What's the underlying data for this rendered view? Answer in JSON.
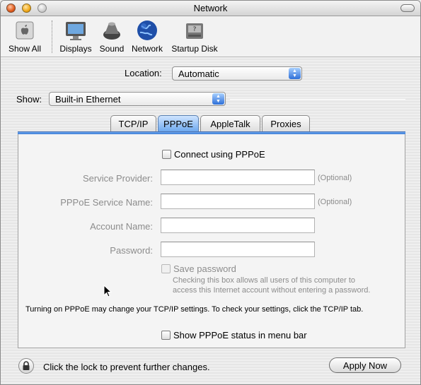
{
  "window": {
    "title": "Network"
  },
  "toolbar": {
    "items": [
      {
        "label": "Show All",
        "icon": "apple-icon"
      },
      {
        "label": "Displays",
        "icon": "display-icon"
      },
      {
        "label": "Sound",
        "icon": "speaker-icon"
      },
      {
        "label": "Network",
        "icon": "globe-icon"
      },
      {
        "label": "Startup Disk",
        "icon": "disk-icon"
      }
    ]
  },
  "location": {
    "label": "Location:",
    "value": "Automatic"
  },
  "show": {
    "label": "Show:",
    "value": "Built-in Ethernet"
  },
  "tabs": [
    {
      "label": "TCP/IP",
      "active": false
    },
    {
      "label": "PPPoE",
      "active": true
    },
    {
      "label": "AppleTalk",
      "active": false
    },
    {
      "label": "Proxies",
      "active": false
    }
  ],
  "pppoe": {
    "connect_label": "Connect using PPPoE",
    "connect_checked": false,
    "fields": [
      {
        "label": "Service Provider:",
        "value": "",
        "note": "(Optional)"
      },
      {
        "label": "PPPoE Service Name:",
        "value": "",
        "note": "(Optional)"
      },
      {
        "label": "Account Name:",
        "value": "",
        "note": ""
      },
      {
        "label": "Password:",
        "value": "",
        "note": ""
      }
    ],
    "save_password_label": "Save password",
    "save_password_hint_1": "Checking this box allows all users of this computer to",
    "save_password_hint_2": "access this Internet account without entering a password.",
    "info_text": "Turning on PPPoE may change your TCP/IP settings. To check your settings, click the TCP/IP tab.",
    "status_label": "Show PPPoE status in menu bar"
  },
  "footer": {
    "lock_text": "Click the lock to prevent further changes.",
    "apply_label": "Apply Now"
  },
  "colors": {
    "accent": "#3d7cd6",
    "disabled_text": "#8c8c8c"
  }
}
